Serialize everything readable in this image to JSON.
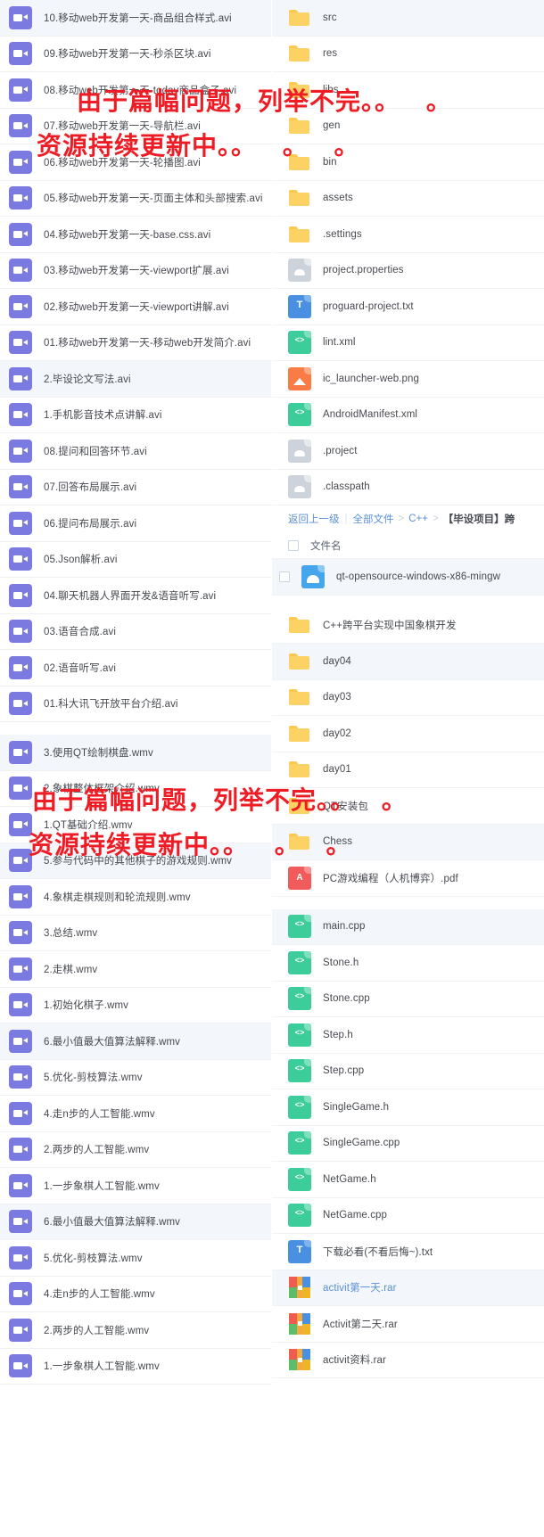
{
  "watermark": {
    "line1": "由于篇幅问题，列举不完。",
    "line1_dots": "。 。",
    "line2": "资源持续更新中。",
    "line2_dots": "。 。 。"
  },
  "left_column": {
    "items": [
      {
        "icon": "video-icon",
        "label": "10.移动web开发第一天-商品组合样式.avi",
        "selected": true,
        "gap_after": false
      },
      {
        "icon": "video-icon",
        "label": "09.移动web开发第一天-秒杀区块.avi",
        "selected": false,
        "gap_after": false
      },
      {
        "icon": "video-icon",
        "label": "08.移动web开发第一天-today商品盒子.avi",
        "selected": false,
        "gap_after": false
      },
      {
        "icon": "video-icon",
        "label": "07.移动web开发第一天-导航栏.avi",
        "selected": false,
        "gap_after": false
      },
      {
        "icon": "video-icon",
        "label": "06.移动web开发第一天-轮播图.avi",
        "selected": false,
        "gap_after": false
      },
      {
        "icon": "video-icon",
        "label": "05.移动web开发第一天-页面主体和头部搜索.avi",
        "selected": false,
        "gap_after": false
      },
      {
        "icon": "video-icon",
        "label": "04.移动web开发第一天-base.css.avi",
        "selected": false,
        "gap_after": false
      },
      {
        "icon": "video-icon",
        "label": "03.移动web开发第一天-viewport扩展.avi",
        "selected": false,
        "gap_after": false
      },
      {
        "icon": "video-icon",
        "label": "02.移动web开发第一天-viewport讲解.avi",
        "selected": false,
        "gap_after": false
      },
      {
        "icon": "video-icon",
        "label": "01.移动web开发第一天-移动web开发简介.avi",
        "selected": false,
        "gap_after": false
      },
      {
        "icon": "video-icon",
        "label": "2.毕设论文写法.avi",
        "selected": true,
        "gap_after": false
      },
      {
        "icon": "video-icon",
        "label": "1.手机影音技术点讲解.avi",
        "selected": false,
        "gap_after": false
      },
      {
        "icon": "video-icon",
        "label": "08.提问和回答环节.avi",
        "selected": false,
        "gap_after": false
      },
      {
        "icon": "video-icon",
        "label": "07.回答布局展示.avi",
        "selected": false,
        "gap_after": false
      },
      {
        "icon": "video-icon",
        "label": "06.提问布局展示.avi",
        "selected": false,
        "gap_after": false
      },
      {
        "icon": "video-icon",
        "label": "05.Json解析.avi",
        "selected": false,
        "gap_after": false
      },
      {
        "icon": "video-icon",
        "label": "04.聊天机器人界面开发&语音听写.avi",
        "selected": false,
        "gap_after": false
      },
      {
        "icon": "video-icon",
        "label": "03.语音合成.avi",
        "selected": false,
        "gap_after": false
      },
      {
        "icon": "video-icon",
        "label": "02.语音听写.avi",
        "selected": false,
        "gap_after": false
      },
      {
        "icon": "video-icon",
        "label": "01.科大讯飞开放平台介绍.avi",
        "selected": false,
        "gap_after": true
      },
      {
        "icon": "video-icon",
        "label": "3.使用QT绘制棋盘.wmv",
        "selected": true,
        "gap_after": false
      },
      {
        "icon": "video-icon",
        "label": "2.象棋整体框架介绍.wmv",
        "selected": false,
        "gap_after": false
      },
      {
        "icon": "video-icon",
        "label": "1.QT基础介绍.wmv",
        "selected": false,
        "gap_after": false
      },
      {
        "icon": "video-icon",
        "label": "5.参与代码中的其他棋子的游戏规则.wmv",
        "selected": true,
        "gap_after": false
      },
      {
        "icon": "video-icon",
        "label": "4.象棋走棋规则和轮流规则.wmv",
        "selected": false,
        "gap_after": false
      },
      {
        "icon": "video-icon",
        "label": "3.总结.wmv",
        "selected": false,
        "gap_after": false
      },
      {
        "icon": "video-icon",
        "label": "2.走棋.wmv",
        "selected": false,
        "gap_after": false
      },
      {
        "icon": "video-icon",
        "label": "1.初始化棋子.wmv",
        "selected": false,
        "gap_after": false
      },
      {
        "icon": "video-icon",
        "label": "6.最小值最大值算法解释.wmv",
        "selected": true,
        "gap_after": false
      },
      {
        "icon": "video-icon",
        "label": "5.优化-剪枝算法.wmv",
        "selected": false,
        "gap_after": false
      },
      {
        "icon": "video-icon",
        "label": "4.走n步的人工智能.wmv",
        "selected": false,
        "gap_after": false
      },
      {
        "icon": "video-icon",
        "label": "2.两步的人工智能.wmv",
        "selected": false,
        "gap_after": false
      },
      {
        "icon": "video-icon",
        "label": "1.一步象棋人工智能.wmv",
        "selected": false,
        "gap_after": false
      },
      {
        "icon": "video-icon",
        "label": "6.最小值最大值算法解释.wmv",
        "selected": true,
        "gap_after": false
      },
      {
        "icon": "video-icon",
        "label": "5.优化-剪枝算法.wmv",
        "selected": false,
        "gap_after": false
      },
      {
        "icon": "video-icon",
        "label": "4.走n步的人工智能.wmv",
        "selected": false,
        "gap_after": false
      },
      {
        "icon": "video-icon",
        "label": "2.两步的人工智能.wmv",
        "selected": false,
        "gap_after": false
      },
      {
        "icon": "video-icon",
        "label": "1.一步象棋人工智能.wmv",
        "selected": false,
        "gap_after": false
      }
    ]
  },
  "right_column": {
    "top_items": [
      {
        "icon": "folder-icon",
        "label": "src",
        "selected": true
      },
      {
        "icon": "folder-icon",
        "label": "res",
        "selected": false
      },
      {
        "icon": "folder-icon",
        "label": "libs",
        "selected": false
      },
      {
        "icon": "folder-icon",
        "label": "gen",
        "selected": false
      },
      {
        "icon": "folder-icon",
        "label": "bin",
        "selected": false
      },
      {
        "icon": "folder-icon",
        "label": "assets",
        "selected": false
      },
      {
        "icon": "folder-icon",
        "label": ".settings",
        "selected": false
      },
      {
        "icon": "doc-icon",
        "label": "project.properties",
        "selected": false
      },
      {
        "icon": "txt-icon",
        "label": "proguard-project.txt",
        "selected": false
      },
      {
        "icon": "code-icon",
        "label": "lint.xml",
        "selected": false
      },
      {
        "icon": "image-icon",
        "label": "ic_launcher-web.png",
        "selected": false
      },
      {
        "icon": "code-icon",
        "label": "AndroidManifest.xml",
        "selected": false
      },
      {
        "icon": "doc-icon",
        "label": ".project",
        "selected": false
      },
      {
        "icon": "doc-icon",
        "label": ".classpath",
        "selected": false
      }
    ],
    "breadcrumb": {
      "back": "返回上一级",
      "root": "全部文件",
      "crumb1": "C++",
      "current": "【毕设项目】跨"
    },
    "table_header": "文件名",
    "bottom_items": [
      {
        "icon": "setup-icon",
        "label": "qt-opensource-windows-x86-mingw",
        "selected": true,
        "checkbox": true,
        "gap_after": true,
        "blue": false
      },
      {
        "icon": "folder-icon",
        "label": "C++跨平台实现中国象棋开发",
        "selected": false,
        "checkbox": false,
        "gap_after": false,
        "blue": false
      },
      {
        "icon": "folder-icon",
        "label": "day04",
        "selected": true,
        "checkbox": false,
        "gap_after": false,
        "blue": false
      },
      {
        "icon": "folder-icon",
        "label": "day03",
        "selected": false,
        "checkbox": false,
        "gap_after": false,
        "blue": false
      },
      {
        "icon": "folder-icon",
        "label": "day02",
        "selected": false,
        "checkbox": false,
        "gap_after": false,
        "blue": false
      },
      {
        "icon": "folder-icon",
        "label": "day01",
        "selected": false,
        "checkbox": false,
        "gap_after": false,
        "blue": false
      },
      {
        "icon": "folder-icon",
        "label": "QT安装包",
        "selected": false,
        "checkbox": false,
        "gap_after": false,
        "blue": false
      },
      {
        "icon": "folder-icon",
        "label": "Chess",
        "selected": true,
        "checkbox": false,
        "gap_after": false,
        "blue": false
      },
      {
        "icon": "pdf-icon",
        "label": "PC游戏编程（人机博弈）.pdf",
        "selected": false,
        "checkbox": false,
        "gap_after": true,
        "blue": false
      },
      {
        "icon": "code-icon",
        "label": "main.cpp",
        "selected": true,
        "checkbox": false,
        "gap_after": false,
        "blue": false
      },
      {
        "icon": "code-icon",
        "label": "Stone.h",
        "selected": false,
        "checkbox": false,
        "gap_after": false,
        "blue": false
      },
      {
        "icon": "code-icon",
        "label": "Stone.cpp",
        "selected": false,
        "checkbox": false,
        "gap_after": false,
        "blue": false
      },
      {
        "icon": "code-icon",
        "label": "Step.h",
        "selected": false,
        "checkbox": false,
        "gap_after": false,
        "blue": false
      },
      {
        "icon": "code-icon",
        "label": "Step.cpp",
        "selected": false,
        "checkbox": false,
        "gap_after": false,
        "blue": false
      },
      {
        "icon": "code-icon",
        "label": "SingleGame.h",
        "selected": false,
        "checkbox": false,
        "gap_after": false,
        "blue": false
      },
      {
        "icon": "code-icon",
        "label": "SingleGame.cpp",
        "selected": false,
        "checkbox": false,
        "gap_after": false,
        "blue": false
      },
      {
        "icon": "code-icon",
        "label": "NetGame.h",
        "selected": false,
        "checkbox": false,
        "gap_after": false,
        "blue": false
      },
      {
        "icon": "code-icon",
        "label": "NetGame.cpp",
        "selected": false,
        "checkbox": false,
        "gap_after": false,
        "blue": false
      },
      {
        "icon": "txt-icon",
        "label": "下载必看(不看后悔~).txt",
        "selected": false,
        "checkbox": false,
        "gap_after": false,
        "blue": false
      },
      {
        "icon": "rar-icon",
        "label": "activit第一天.rar",
        "selected": true,
        "checkbox": false,
        "gap_after": false,
        "blue": true
      },
      {
        "icon": "rar-icon",
        "label": "Activit第二天.rar",
        "selected": false,
        "checkbox": false,
        "gap_after": false,
        "blue": false
      },
      {
        "icon": "rar-icon",
        "label": "activit资料.rar",
        "selected": false,
        "checkbox": false,
        "gap_after": false,
        "blue": false
      }
    ]
  }
}
